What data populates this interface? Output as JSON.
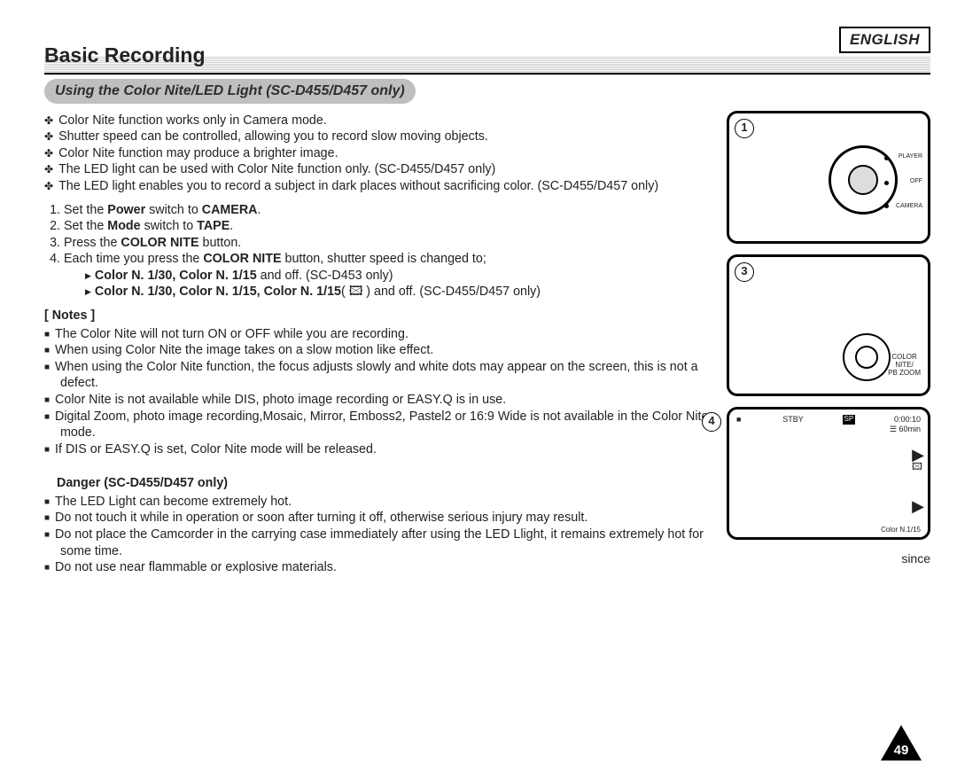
{
  "lang": "ENGLISH",
  "title": "Basic Recording",
  "subtitle": "Using the Color Nite/LED Light (SC-D455/D457 only)",
  "diamonds": [
    "Color Nite function works only in Camera mode.",
    "Shutter speed can be controlled, allowing you to record slow moving objects.",
    "Color Nite function may produce a brighter image.",
    "The LED light can be used with Color Nite function only. (SC-D455/D457 only)",
    "The LED light enables you to record a subject in dark places without sacrificing color. (SC-D455/D457 only)"
  ],
  "steps": {
    "s1": {
      "pre": "Set the ",
      "b1": "Power",
      "mid": " switch to ",
      "b2": "CAMERA",
      "post": "."
    },
    "s2": {
      "pre": "Set the ",
      "b1": "Mode",
      "mid": " switch to ",
      "b2": "TAPE",
      "post": "."
    },
    "s3": {
      "pre": "Press the ",
      "b1": "COLOR NITE",
      "post": " button."
    },
    "s4": {
      "pre": "Each time you press the ",
      "b1": "COLOR NITE",
      "post": " button, shutter speed is changed to;"
    },
    "s4a_b": "Color N. 1/30, Color N. 1/15",
    "s4a_rest": " and off. (SC-D453 only)",
    "s4b_b": "Color N. 1/30, Color N. 1/15, Color N. 1/15",
    "s4b_rest": "( 🖾 ) and off. (SC-D455/D457 only)"
  },
  "notes_head": "[ Notes ]",
  "notes": [
    "The Color Nite will not turn ON or OFF while you are recording.",
    "When using Color Nite the image takes on a slow motion like effect.",
    "When using the Color Nite function, the focus adjusts slowly and white dots may appear on the screen, this is not a defect.",
    "Color Nite is not available while DIS, photo image recording or EASY.Q is in use.",
    "Digital Zoom, photo image recording,Mosaic, Mirror, Emboss2, Pastel2 or 16:9 Wide is not available in the Color Nite mode.",
    "If DIS or EASY.Q is set, Color Nite mode will be released."
  ],
  "danger_head": "Danger (SC-D455/D457 only)",
  "danger": [
    "The LED Light can become extremely hot.",
    "Do not touch it while in operation or soon after turning it off, otherwise serious injury may result.",
    "Do not place the Camcorder in the carrying case immediately after using the LED Llight, it remains extremely hot for some time.",
    "Do not use near flammable or explosive materials."
  ],
  "since": "since",
  "fig": {
    "n1": "1",
    "n3": "3",
    "n4": "4",
    "player": "PLAYER",
    "off": "OFF",
    "camera": "CAMERA",
    "color": "COLOR",
    "nite": "NITE/",
    "pbzoom": "PB ZOOM",
    "stby": "STBY",
    "sp": "SP",
    "time": "0:00:10",
    "mins": "60min",
    "cn": "Color N.1/15"
  },
  "page": "49"
}
